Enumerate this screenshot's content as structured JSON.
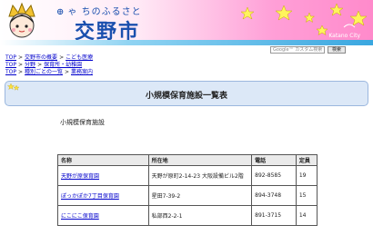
{
  "header": {
    "site_title": "ゃ ちのふるさと",
    "city_name": "交野市",
    "subtitle_en": "Katano City"
  },
  "search": {
    "placeholder": "Google™ カスタム検索",
    "button_label": "検索"
  },
  "breadcrumbs": [
    [
      {
        "label": "TOP"
      },
      {
        "label": "交野市の概要"
      },
      {
        "label": "こども医療"
      }
    ],
    [
      {
        "label": "TOP"
      },
      {
        "label": "分野"
      },
      {
        "label": "保育所・幼稚園"
      }
    ],
    [
      {
        "label": "TOP"
      },
      {
        "label": "種別ごとの一覧"
      },
      {
        "label": "業務案内"
      }
    ]
  ],
  "page": {
    "title": "小規模保育施設一覧表",
    "section_heading": "小規模保育施設"
  },
  "table": {
    "headers": [
      "名称",
      "所在地",
      "電話",
      "定員"
    ],
    "rows": [
      {
        "name": "天野が原保育園",
        "address": "天野が原町2-14-23 大阪設備ビル2階",
        "phone": "892-8585",
        "capacity": "19"
      },
      {
        "name": "ぽっかぽか7丁目保育園",
        "address": "星田7-39-2",
        "phone": "894-3748",
        "capacity": "15"
      },
      {
        "name": "にこにこ保育園",
        "address": "私部西2-2-1",
        "phone": "891-3715",
        "capacity": "14"
      }
    ]
  },
  "colors": {
    "header_pink": "#ff8acb",
    "title_band": "#dce8f7",
    "link": "#0000cc",
    "city_name": "#1a4fae"
  }
}
